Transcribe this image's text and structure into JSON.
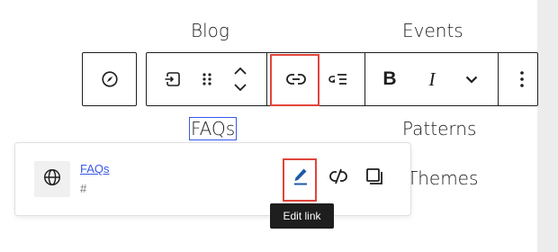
{
  "nav": {
    "blog": "Blog",
    "events": "Events",
    "faqs": "FAQs",
    "patterns": "Patterns",
    "themes": "Themes"
  },
  "toolbar": {
    "buttons": [
      {
        "name": "navigation-block-icon"
      },
      {
        "name": "transform-to-link-icon"
      },
      {
        "name": "drag-handle-icon"
      },
      {
        "name": "move-up-down-icon"
      },
      {
        "name": "link-icon"
      },
      {
        "name": "add-submenu-icon"
      },
      {
        "name": "bold-icon",
        "label": "B"
      },
      {
        "name": "italic-icon",
        "label": "I"
      },
      {
        "name": "more-rich-text-chevron-icon"
      },
      {
        "name": "options-kebab-icon"
      }
    ]
  },
  "link_popover": {
    "title": "FAQs",
    "url": "#",
    "icon": "globe-icon",
    "actions": [
      "edit-link",
      "unlink",
      "copy-link"
    ]
  },
  "tooltip": {
    "text": "Edit link"
  },
  "colors": {
    "accent": "#3858e9",
    "highlight": "#e0453a",
    "text": "#1e1e1e"
  }
}
